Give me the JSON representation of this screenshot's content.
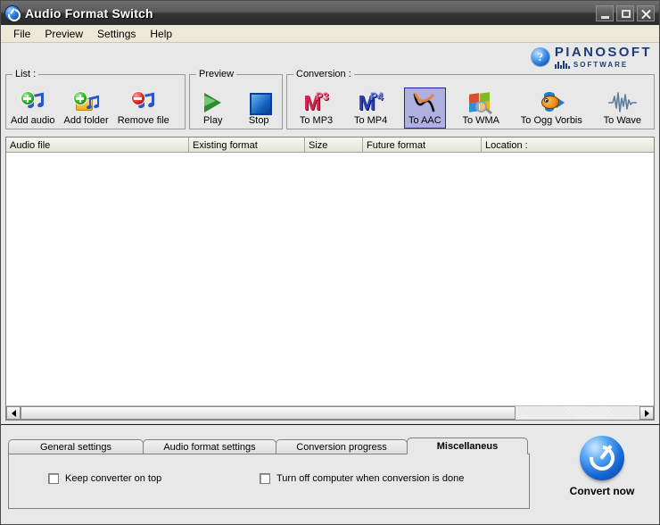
{
  "window": {
    "title": "Audio Format Switch",
    "icon": "app-logo-icon",
    "minimize_label": "Minimize",
    "maximize_label": "Maximize",
    "close_label": "Close"
  },
  "menu": {
    "items": [
      {
        "label": "File"
      },
      {
        "label": "Preview"
      },
      {
        "label": "Settings"
      },
      {
        "label": "Help"
      }
    ]
  },
  "logo": {
    "help_icon": "question-mark-icon",
    "brand": "PIANOSOFT",
    "sub": "SOFTWARE"
  },
  "toolbar": {
    "groups": [
      {
        "label": "List :",
        "buttons": [
          {
            "label": "Add audio",
            "icon": "add-audio-icon"
          },
          {
            "label": "Add folder",
            "icon": "add-folder-icon"
          },
          {
            "label": "Remove file",
            "icon": "remove-file-icon"
          }
        ]
      },
      {
        "label": "Preview",
        "buttons": [
          {
            "label": "Play",
            "icon": "play-icon"
          },
          {
            "label": "Stop",
            "icon": "stop-icon"
          }
        ]
      },
      {
        "label": "Conversion :",
        "buttons": [
          {
            "label": "To MP3",
            "icon": "mp3-icon",
            "selected": false
          },
          {
            "label": "To MP4",
            "icon": "mp4-icon",
            "selected": false
          },
          {
            "label": "To AAC",
            "icon": "aac-icon",
            "selected": true
          },
          {
            "label": "To WMA",
            "icon": "windows-media-icon",
            "selected": false
          },
          {
            "label": "To Ogg Vorbis",
            "icon": "ogg-fish-icon",
            "selected": false
          },
          {
            "label": "To Wave",
            "icon": "waveform-icon",
            "selected": false
          }
        ]
      }
    ]
  },
  "file_list": {
    "columns": [
      {
        "label": "Audio file"
      },
      {
        "label": "Existing format"
      },
      {
        "label": "Size"
      },
      {
        "label": "Future format"
      },
      {
        "label": "Location :"
      }
    ],
    "rows": [],
    "scrollbar": {
      "left_arrow": "scroll-left-icon",
      "right_arrow": "scroll-right-icon"
    }
  },
  "tabs": [
    {
      "label": "General settings",
      "active": false
    },
    {
      "label": "Audio format settings",
      "active": false
    },
    {
      "label": "Conversion progress",
      "active": false
    },
    {
      "label": "Miscellaneus",
      "active": true
    }
  ],
  "miscellaneus": {
    "checkboxes": [
      {
        "label": "Keep converter on top",
        "checked": false
      },
      {
        "label": "Turn off computer when conversion is done",
        "checked": false
      }
    ]
  },
  "convert": {
    "label": "Convert now",
    "icon": "convert-orb-icon"
  },
  "colors": {
    "titlebar_dark": "#2b2b2b",
    "titlebar_light": "#6e6e6e",
    "panel_bg": "#e8e8e8",
    "menu_bg": "#ece9d8",
    "brand_blue": "#1b3d77",
    "selected_tool_bg": "#b0b0e0",
    "selected_tool_border": "#2222aa"
  }
}
